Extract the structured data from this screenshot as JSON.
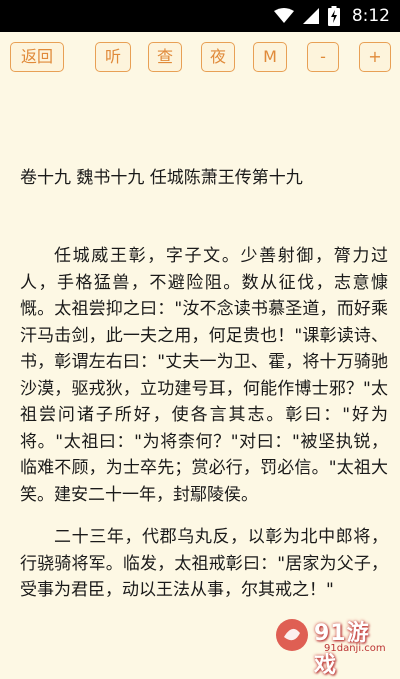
{
  "status_bar": {
    "time": "8:12",
    "icons": [
      "wifi-icon",
      "signal-icon",
      "battery-icon"
    ]
  },
  "toolbar": {
    "back_label": "返回",
    "listen_label": "听",
    "lookup_label": "查",
    "night_label": "夜",
    "menu_label": "M",
    "font_decrease_label": "-",
    "font_increase_label": "+"
  },
  "content": {
    "chapter_title": "卷十九 魏书十九 任城陈萧王传第十九",
    "paragraphs": [
      "任城威王彰，字子文。少善射御，膂力过人，手格猛兽，不避险阻。数从征伐，志意慷慨。太祖尝抑之曰：\"汝不念读书慕圣道，而好乘汗马击剑，此一夫之用，何足贵也！\"课彰读诗、书，彰谓左右曰：\"丈夫一为卫、霍，将十万骑驰沙漠，驱戎狄，立功建号耳，何能作博士邪？\"太祖尝问诸子所好，使各言其志。彰曰：\"好为将。\"太祖曰：\"为将柰何？\"对曰：\"被坚执锐，临难不顾，为士卒先；赏必行，罚必信。\"太祖大笑。建安二十一年，封鄢陵侯。",
      "二十三年，代郡乌丸反，以彰为北中郎将，行骁骑将军。临发，太祖戒彰曰：\"居家为父子，受事为君臣，动以王法从事，尔其戒之！\""
    ]
  },
  "watermark": {
    "brand": "91游戏",
    "site": "91danji.com"
  },
  "colors": {
    "background": "#fdf8e4",
    "button_border": "#e8a055",
    "button_text": "#e08a3a",
    "status_bar": "#000000"
  }
}
